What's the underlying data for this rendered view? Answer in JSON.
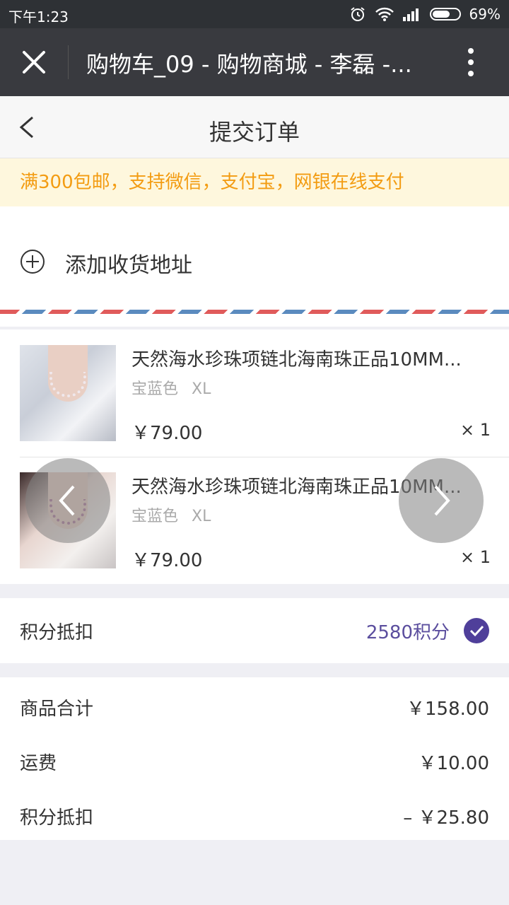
{
  "status_bar": {
    "time": "下午1:23",
    "battery": "69%",
    "battery_level": 0.69
  },
  "web_header": {
    "title": "购物车_09 - 购物商城 - 李磊 -..."
  },
  "page": {
    "title": "提交订单"
  },
  "notice": {
    "text": "满300包邮，支持微信，支付宝，网银在线支付"
  },
  "address": {
    "label": "添加收货地址"
  },
  "products": [
    {
      "name": "天然海水珍珠项链北海南珠正品10MM...",
      "color": "宝蓝色",
      "size": "XL",
      "price": "￥79.00",
      "qty": "× 1"
    },
    {
      "name": "天然海水珍珠项链北海南珠正品10MM...",
      "color": "宝蓝色",
      "size": "XL",
      "price": "￥79.00",
      "qty": "× 1"
    }
  ],
  "points": {
    "label": "积分抵扣",
    "value": "2580积分",
    "accent_color": "#4f3f9a"
  },
  "summary": {
    "goods_label": "商品合计",
    "goods_value": "￥158.00",
    "shipping_label": "运费",
    "shipping_value": "￥10.00",
    "points_label": "积分抵扣",
    "points_value": "– ￥25.80"
  },
  "colors": {
    "notice_text": "#f39c12",
    "notice_bg": "#fef7dd",
    "header_bg": "#393a3f"
  }
}
